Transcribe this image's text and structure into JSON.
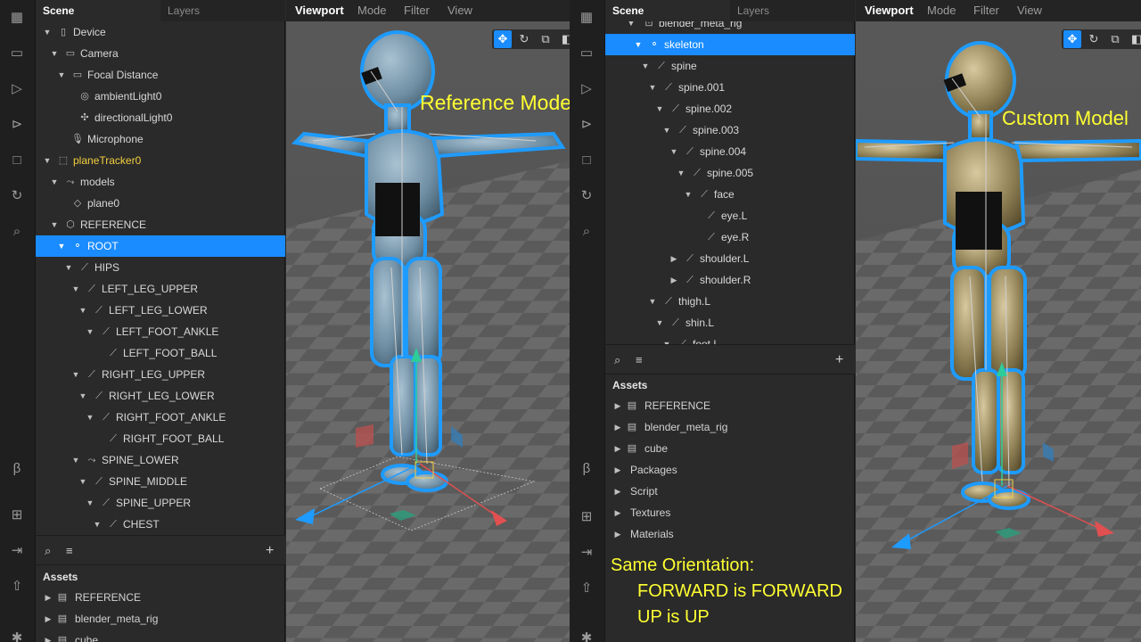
{
  "left": {
    "toolbar": {
      "icons": [
        "layout-icon",
        "camera-icon",
        "play-icon",
        "step-icon",
        "stop-icon",
        "refresh-icon",
        "search-icon",
        "beta-icon",
        "add-icon",
        "import-icon",
        "upload-icon",
        "bug-icon"
      ]
    },
    "panel_tabs": {
      "scene": "Scene",
      "layers": "Layers"
    },
    "tree": [
      {
        "label": "Device",
        "depth": 0,
        "arrow": "down",
        "icon": "device-icon"
      },
      {
        "label": "Camera",
        "depth": 1,
        "arrow": "down",
        "icon": "camera-icon"
      },
      {
        "label": "Focal Distance",
        "depth": 2,
        "arrow": "down",
        "icon": "ruler-icon"
      },
      {
        "label": "ambientLight0",
        "depth": 3,
        "arrow": "none",
        "icon": "globe-icon"
      },
      {
        "label": "directionalLight0",
        "depth": 3,
        "arrow": "none",
        "icon": "light-icon"
      },
      {
        "label": "Microphone",
        "depth": 2,
        "arrow": "none",
        "icon": "microphone-icon"
      },
      {
        "label": "planeTracker0",
        "depth": 0,
        "arrow": "down",
        "icon": "tracker-icon",
        "style": "yellow"
      },
      {
        "label": "models",
        "depth": 1,
        "arrow": "down",
        "icon": "null-object-icon"
      },
      {
        "label": "plane0",
        "depth": 2,
        "arrow": "none",
        "icon": "plane-icon"
      },
      {
        "label": "REFERENCE",
        "depth": 1,
        "arrow": "down",
        "icon": "cube-icon"
      },
      {
        "label": "ROOT",
        "depth": 2,
        "arrow": "down",
        "icon": "joint-icon",
        "style": "selected"
      },
      {
        "label": "HIPS",
        "depth": 3,
        "arrow": "down",
        "icon": "bone-icon"
      },
      {
        "label": "LEFT_LEG_UPPER",
        "depth": 4,
        "arrow": "down",
        "icon": "bone-icon"
      },
      {
        "label": "LEFT_LEG_LOWER",
        "depth": 5,
        "arrow": "down",
        "icon": "bone-icon"
      },
      {
        "label": "LEFT_FOOT_ANKLE",
        "depth": 6,
        "arrow": "down",
        "icon": "bone-icon"
      },
      {
        "label": "LEFT_FOOT_BALL",
        "depth": 7,
        "arrow": "none",
        "icon": "bone-icon"
      },
      {
        "label": "RIGHT_LEG_UPPER",
        "depth": 4,
        "arrow": "down",
        "icon": "bone-icon"
      },
      {
        "label": "RIGHT_LEG_LOWER",
        "depth": 5,
        "arrow": "down",
        "icon": "bone-icon"
      },
      {
        "label": "RIGHT_FOOT_ANKLE",
        "depth": 6,
        "arrow": "down",
        "icon": "bone-icon"
      },
      {
        "label": "RIGHT_FOOT_BALL",
        "depth": 7,
        "arrow": "none",
        "icon": "bone-icon"
      },
      {
        "label": "SPINE_LOWER",
        "depth": 4,
        "arrow": "down",
        "icon": "null-object-icon"
      },
      {
        "label": "SPINE_MIDDLE",
        "depth": 5,
        "arrow": "down",
        "icon": "bone-icon"
      },
      {
        "label": "SPINE_UPPER",
        "depth": 6,
        "arrow": "down",
        "icon": "bone-icon"
      },
      {
        "label": "CHEST",
        "depth": 7,
        "arrow": "down",
        "icon": "bone-icon"
      }
    ],
    "assets_title": "Assets",
    "assets": [
      {
        "label": "REFERENCE",
        "icon": "file-icon"
      },
      {
        "label": "blender_meta_rig",
        "icon": "file-icon"
      },
      {
        "label": "cube",
        "icon": "file-icon"
      }
    ],
    "viewport_tabs": [
      "Viewport",
      "Mode",
      "Filter",
      "View"
    ],
    "annotation": "Reference Model",
    "model_color": "#6f8ea3"
  },
  "right": {
    "panel_tabs": {
      "scene": "Scene",
      "layers": "Layers"
    },
    "tree_partial_top": "blender_meta_rig",
    "tree": [
      {
        "label": "skeleton",
        "depth": 0,
        "arrow": "down",
        "icon": "joint-icon",
        "style": "selected"
      },
      {
        "label": "spine",
        "depth": 1,
        "arrow": "down",
        "icon": "bone-icon"
      },
      {
        "label": "spine.001",
        "depth": 2,
        "arrow": "down",
        "icon": "bone-icon"
      },
      {
        "label": "spine.002",
        "depth": 3,
        "arrow": "down",
        "icon": "bone-icon"
      },
      {
        "label": "spine.003",
        "depth": 4,
        "arrow": "down",
        "icon": "bone-icon"
      },
      {
        "label": "spine.004",
        "depth": 5,
        "arrow": "down",
        "icon": "bone-icon"
      },
      {
        "label": "spine.005",
        "depth": 6,
        "arrow": "down",
        "icon": "bone-icon"
      },
      {
        "label": "face",
        "depth": 7,
        "arrow": "down",
        "icon": "bone-icon"
      },
      {
        "label": "eye.L",
        "depth": 8,
        "arrow": "none",
        "icon": "bone-icon"
      },
      {
        "label": "eye.R",
        "depth": 8,
        "arrow": "none",
        "icon": "bone-icon"
      },
      {
        "label": "shoulder.L",
        "depth": 5,
        "arrow": "right",
        "icon": "bone-icon"
      },
      {
        "label": "shoulder.R",
        "depth": 5,
        "arrow": "right",
        "icon": "bone-icon"
      },
      {
        "label": "thigh.L",
        "depth": 2,
        "arrow": "down",
        "icon": "bone-icon"
      },
      {
        "label": "shin.L",
        "depth": 3,
        "arrow": "down",
        "icon": "bone-icon"
      },
      {
        "label": "foot.L",
        "depth": 4,
        "arrow": "down",
        "icon": "bone-icon"
      }
    ],
    "assets_title": "Assets",
    "assets": [
      {
        "label": "REFERENCE",
        "icon": "file-icon"
      },
      {
        "label": "blender_meta_rig",
        "icon": "file-icon"
      },
      {
        "label": "cube",
        "icon": "file-icon"
      },
      {
        "label": "Packages",
        "icon": ""
      },
      {
        "label": "Script",
        "icon": ""
      },
      {
        "label": "Textures",
        "icon": ""
      },
      {
        "label": "Materials",
        "icon": ""
      }
    ],
    "viewport_tabs": [
      "Viewport",
      "Mode",
      "Filter",
      "View"
    ],
    "annotation": "Custom Model",
    "note_line1": "Same Orientation:",
    "note_line2": "FORWARD is FORWARD",
    "note_line3": "UP is UP",
    "model_color": "#8c7d52"
  },
  "colors": {
    "selection": "#1a8cff",
    "outline": "#1e9bff",
    "annotation": "#ffff33",
    "tracker": "#f4d03f"
  }
}
